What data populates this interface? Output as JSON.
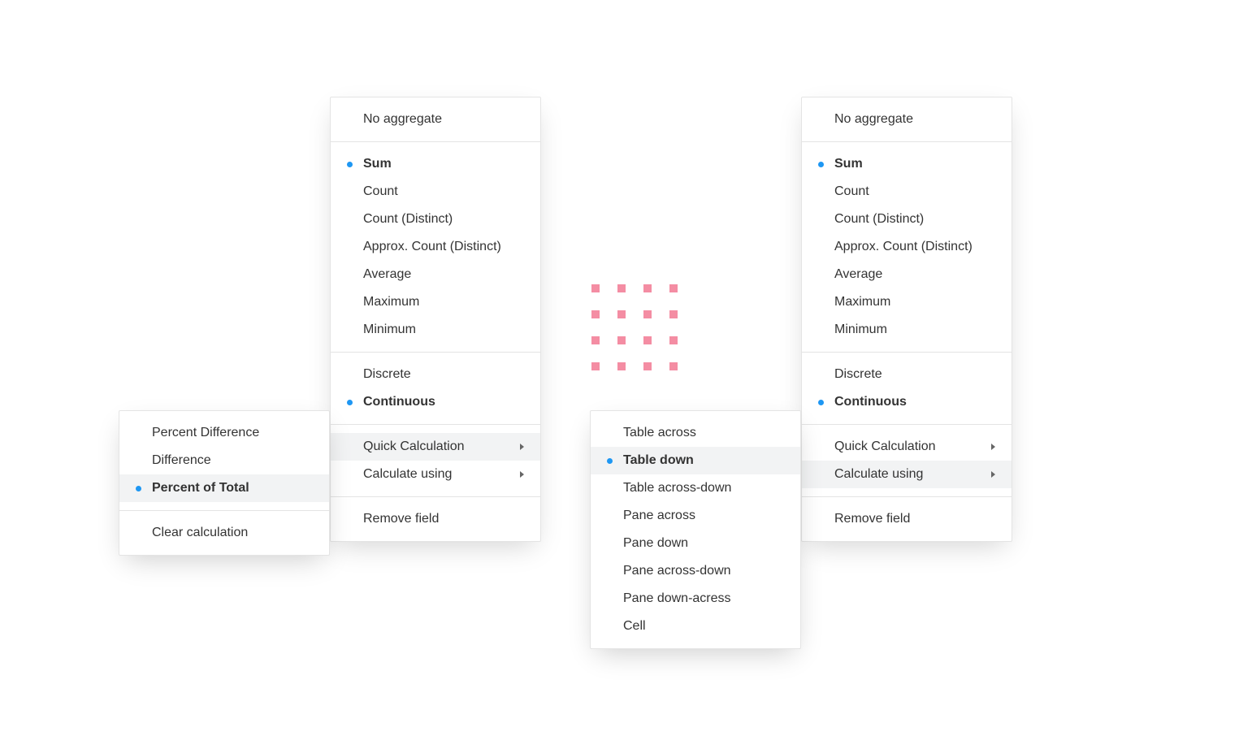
{
  "accent": "#1e97f3",
  "grid_color": "#f48da3",
  "main_menu": {
    "no_aggregate": "No aggregate",
    "aggregates": {
      "sum": "Sum",
      "count": "Count",
      "count_distinct": "Count (Distinct)",
      "approx_count_distinct": "Approx. Count (Distinct)",
      "average": "Average",
      "maximum": "Maximum",
      "minimum": "Minimum"
    },
    "type": {
      "discrete": "Discrete",
      "continuous": "Continuous"
    },
    "calc": {
      "quick_calculation": "Quick Calculation",
      "calculate_using": "Calculate using"
    },
    "remove_field": "Remove field"
  },
  "quick_calc_submenu": {
    "percent_difference": "Percent Difference",
    "difference": "Difference",
    "percent_of_total": "Percent of Total",
    "clear_calculation": "Clear calculation"
  },
  "calculate_using_submenu": {
    "table_across": "Table across",
    "table_down": "Table down",
    "table_across_down": "Table across-down",
    "pane_across": "Pane across",
    "pane_down": "Pane down",
    "pane_across_down": "Pane across-down",
    "pane_down_across": "Pane down-acress",
    "cell": "Cell"
  }
}
